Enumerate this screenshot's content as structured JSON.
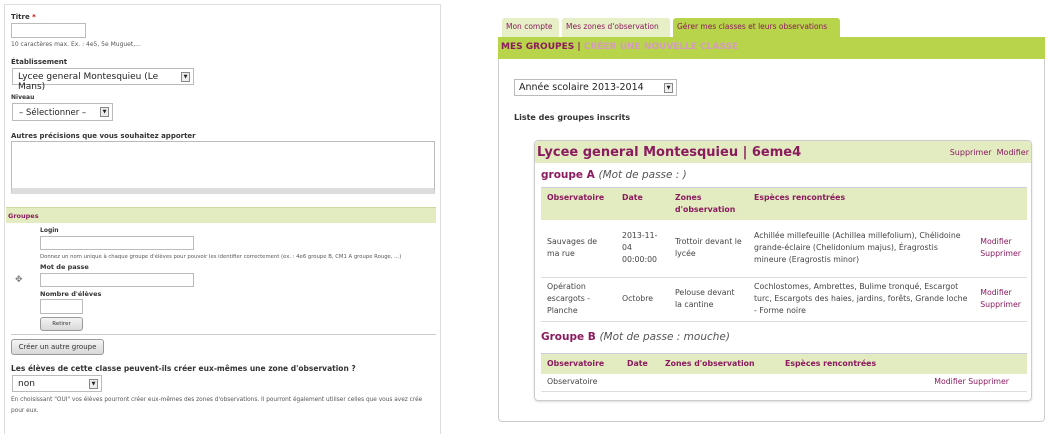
{
  "form": {
    "title_label": "Titre",
    "required_mark": "*",
    "title_help": "10 caractères max. Ex. : 4e5, 5e Muguet,...",
    "etab_label": "Établissement",
    "etab_value": "Lycee general Montesquieu (Le Mans)",
    "niveau_label": "Niveau",
    "niveau_value": "– Sélectionner –",
    "autres_label": "Autres précisions que vous souhaitez apporter",
    "groupes_label": "Groupes",
    "login_label": "Login",
    "login_help": "Donnez un nom unique à chaque groupe d'élèves pour pouvoir les identifier correctement (ex. : 4e6 groupe B, CM1 A groupe Rouge, ...)",
    "password_label": "Mot de passe",
    "count_label": "Nombre d'élèves",
    "remove_button": "Retirer",
    "add_group_button": "Créer un autre groupe",
    "zone_question": "Les élèves de cette classe peuvent-ils créer eux-mêmes une zone d'observation ?",
    "zone_value": "non",
    "zone_help": "En choisissant \"OUI\" vos élèves pourront créer eux-mêmes des zones d'observations. Il pourront également utiliser celles que vous avez crée pour eux."
  },
  "tabs": [
    "Mon compte",
    "Mes zones d'observation",
    "Gérer mes classes et leurs observations"
  ],
  "subnav": {
    "current": "MES GROUPES",
    "sep": "|",
    "new": "CRÉER UNE NOUVELLE CLASSE"
  },
  "year_select": "Année scolaire 2013-2014",
  "list_title": "Liste des groupes inscrits",
  "card": {
    "title": "Lycee general Montesquieu | 6eme4",
    "delete": "Supprimer",
    "edit": "Modifier"
  },
  "groupA": {
    "name": "groupe A",
    "pw": "(Mot de passe :              )",
    "headers": [
      "Observatoire",
      "Date",
      "Zones d'observation",
      "Espèces rencontrées"
    ],
    "rows": [
      {
        "obs": "Sauvages de ma rue",
        "date": "2013-11-04 00:00:00",
        "zone": "Trottoir devant le lycée",
        "species": "Achillée millefeuille (Achillea millefolium), Chélidoine grande-éclaire (Chelidonium majus), Éragrostis mineure (Eragrostis minor)",
        "edit": "Modifier",
        "delete": "Supprimer"
      },
      {
        "obs": "Opération escargots - Planche",
        "date": "Octobre",
        "zone": "Pelouse devant la cantine",
        "species": "Cochlostomes, Ambrettes, Bulime tronqué, Escargot turc, Escargots des haies, jardins, forêts, Grande loche - Forme noire",
        "edit": "Modifier",
        "delete": "Supprimer"
      }
    ]
  },
  "groupB": {
    "name": "Groupe B",
    "pw": "(Mot de passe : mouche)",
    "headers": [
      "Observatoire",
      "Date",
      "Zones d'observation",
      "Espèces rencontrées"
    ],
    "rows": [
      {
        "obs": "Observatoire",
        "edit": "Modifier",
        "delete": "Supprimer"
      }
    ]
  },
  "colors": {
    "accent": "#8b1a5e",
    "green": "#b8d44a",
    "light_green": "#e2ecc0"
  }
}
